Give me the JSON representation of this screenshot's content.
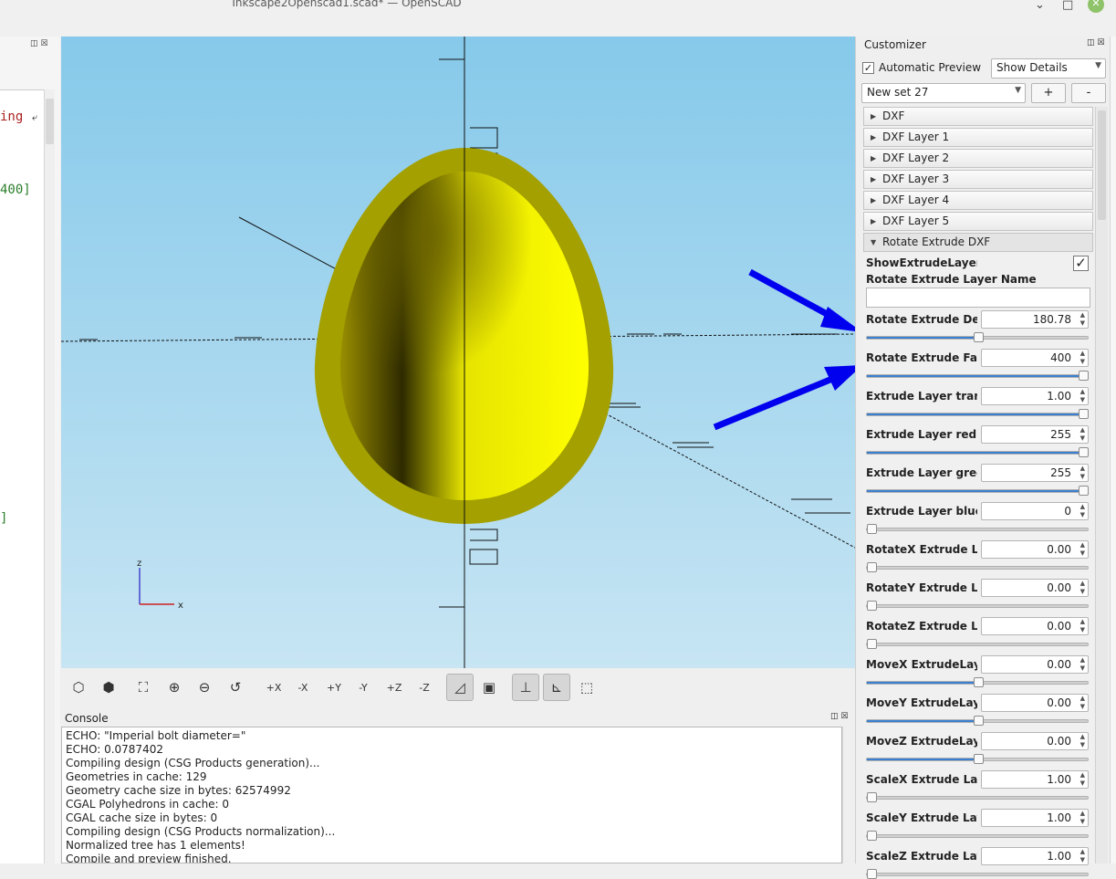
{
  "window": {
    "title": "Inkscape2Openscad1.scad* — OpenSCAD",
    "minimize_glyph": "⌄",
    "maximize_glyph": "□",
    "close_glyph": "✕"
  },
  "editor": {
    "dock_icons": "◫ ☒",
    "lines": [
      {
        "text": "ing",
        "color": "#aa2222"
      },
      {
        "text": "400]",
        "color": "#2a7d2a"
      },
      {
        "text": "]",
        "color": "#2a7d2a"
      }
    ],
    "wrap_glyph": "⤶"
  },
  "viewport": {
    "colors": {
      "sky_top": "#86c9ea",
      "sky_bottom": "#c7e5f3",
      "shell": "#a3a000",
      "interior": "#ffff00",
      "arrow": "#0000ee"
    },
    "axis_labels": {
      "z": "z",
      "x": "x"
    }
  },
  "toolbar": {
    "buttons": [
      {
        "name": "preview-render-icon",
        "glyph": "⬡"
      },
      {
        "name": "render-icon",
        "glyph": "⬢"
      },
      {
        "name": "view-all-icon",
        "glyph": "⛶"
      },
      {
        "name": "zoom-in-icon",
        "glyph": "⊕"
      },
      {
        "name": "zoom-out-icon",
        "glyph": "⊖"
      },
      {
        "name": "reset-view-icon",
        "glyph": "↺"
      },
      {
        "name": "view-right-icon",
        "glyph": "+X"
      },
      {
        "name": "view-left-icon",
        "glyph": "-X"
      },
      {
        "name": "view-back-icon",
        "glyph": "+Y"
      },
      {
        "name": "view-front-icon",
        "glyph": "-Y"
      },
      {
        "name": "view-top-icon",
        "glyph": "+Z"
      },
      {
        "name": "view-bottom-icon",
        "glyph": "-Z"
      },
      {
        "name": "perspective-icon",
        "glyph": "◿"
      },
      {
        "name": "orthogonal-icon",
        "glyph": "▣"
      },
      {
        "name": "show-axes-icon",
        "glyph": "⊥"
      },
      {
        "name": "show-scale-markers-icon",
        "glyph": "⊾"
      },
      {
        "name": "show-edges-icon",
        "glyph": "⬚"
      }
    ]
  },
  "console": {
    "title": "Console",
    "dock_icons": "◫ ☒",
    "lines": [
      "ECHO: \"Imperial bolt diameter=\"",
      "ECHO: 0.0787402",
      "Compiling design (CSG Products generation)...",
      "Geometries in cache: 129",
      "Geometry cache size in bytes: 62574992",
      "CGAL Polyhedrons in cache: 0",
      "CGAL cache size in bytes: 0",
      "Compiling design (CSG Products normalization)...",
      "Normalized tree has 1 elements!",
      "Compile and preview finished."
    ]
  },
  "customizer": {
    "title": "Customizer",
    "dock_icons": "◫ ☒",
    "automatic_preview_label": "Automatic Preview",
    "automatic_preview_checked": "✓",
    "details_select": "Show Details",
    "preset_select": "New set 27",
    "add_label": "+",
    "remove_label": "-",
    "groups": [
      {
        "label": "DXF",
        "open": false
      },
      {
        "label": "DXF Layer 1",
        "open": false
      },
      {
        "label": "DXF Layer 2",
        "open": false
      },
      {
        "label": "DXF Layer 3",
        "open": false
      },
      {
        "label": "DXF Layer 4",
        "open": false
      },
      {
        "label": "DXF Layer 5",
        "open": false
      },
      {
        "label": "Rotate Extrude DXF",
        "open": true
      }
    ],
    "show_extrude_label": "ShowExtrudeLayer",
    "show_extrude_checked": "✓",
    "layer_name_label": "Rotate Extrude Layer Name",
    "layer_name_value": "",
    "params": [
      {
        "label": "Rotate Extrude Degrees",
        "value": "180.78",
        "fraction": 0.5
      },
      {
        "label": "Rotate Extrude Faces",
        "value": "400",
        "fraction": 1.0
      },
      {
        "label": "Extrude Layer transparency",
        "value": "1.00",
        "fraction": 1.0
      },
      {
        "label": "Extrude Layer red",
        "value": "255",
        "fraction": 1.0
      },
      {
        "label": "Extrude Layer green",
        "value": "255",
        "fraction": 1.0
      },
      {
        "label": "Extrude Layer blue",
        "value": "0",
        "fraction": 0.0
      },
      {
        "label": "RotateX Extrude Layer",
        "value": "0.00",
        "fraction": 0.0
      },
      {
        "label": "RotateY Extrude Layer",
        "value": "0.00",
        "fraction": 0.0
      },
      {
        "label": "RotateZ Extrude Layer",
        "value": "0.00",
        "fraction": 0.0
      },
      {
        "label": "MoveX ExtrudeLayer",
        "value": "0.00",
        "fraction": 0.5
      },
      {
        "label": "MoveY ExtrudeLayer",
        "value": "0.00",
        "fraction": 0.5
      },
      {
        "label": "MoveZ ExtrudeLayer",
        "value": "0.00",
        "fraction": 0.5
      },
      {
        "label": "ScaleX Extrude Layer",
        "value": "1.00",
        "fraction": 0.0
      },
      {
        "label": "ScaleY Extrude Layer",
        "value": "1.00",
        "fraction": 0.0
      },
      {
        "label": "ScaleZ Extrude Layer",
        "value": "1.00",
        "fraction": 0.0
      }
    ]
  }
}
